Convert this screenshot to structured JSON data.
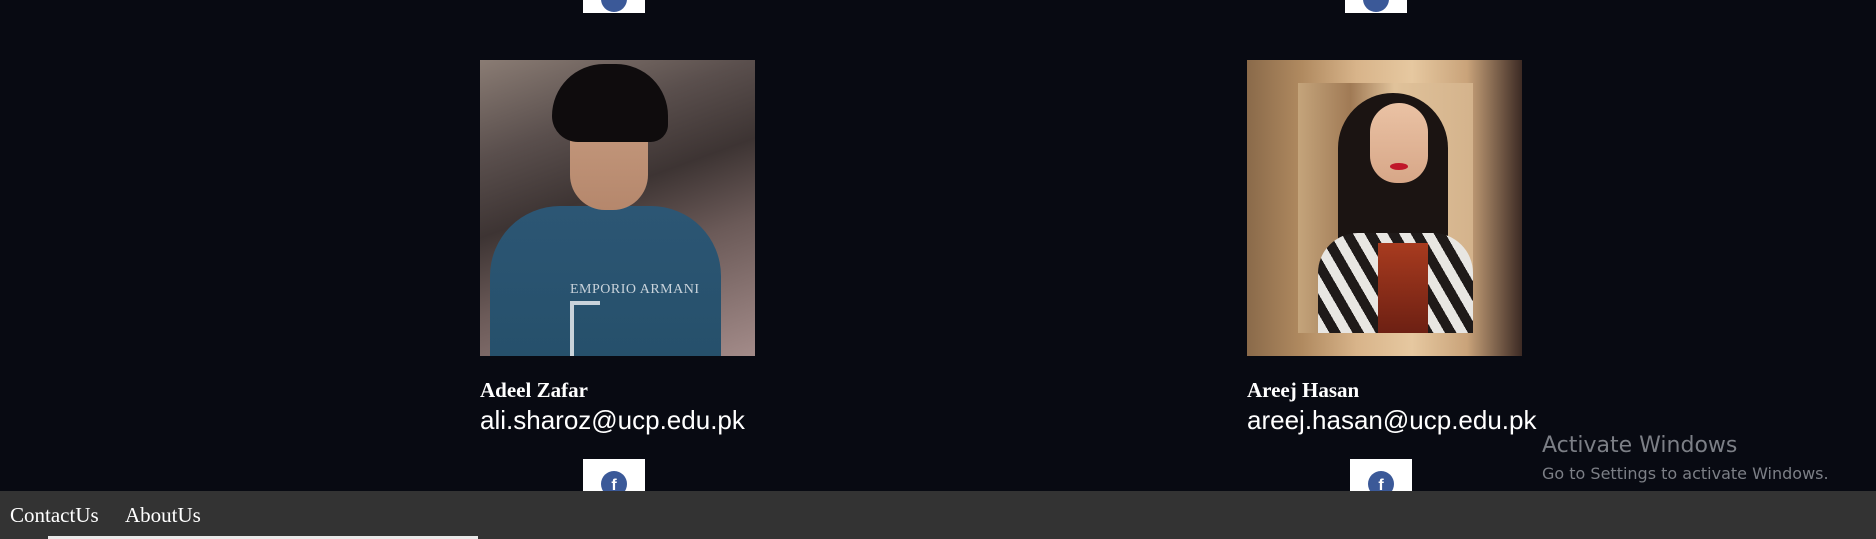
{
  "members": [
    {
      "name": "Adeel Zafar",
      "email": "ali.sharoz@ucp.edu.pk",
      "shirt_text": "EMPORIO ARMANI"
    },
    {
      "name": "Areej Hasan",
      "email": "areej.hasan@ucp.edu.pk"
    }
  ],
  "icons": {
    "social": "facebook-icon"
  },
  "facebook_glyph": "f",
  "footer": {
    "contact_label": "ContactUs",
    "about_label": "AboutUs"
  },
  "watermark": {
    "title": "Activate Windows",
    "subtitle": "Go to Settings to activate Windows."
  },
  "colors": {
    "background": "#080a12",
    "footer": "#333333",
    "facebook_blue": "#3b5998"
  }
}
